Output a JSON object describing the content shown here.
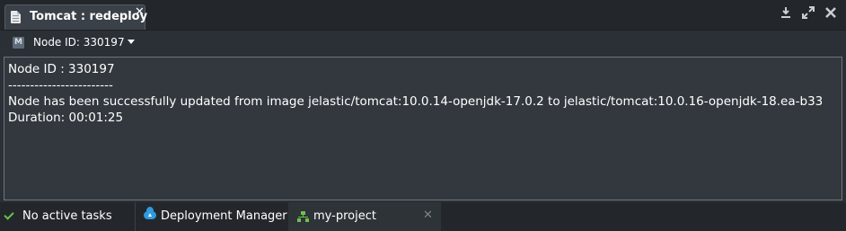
{
  "window": {
    "tab_title": "Tomcat : redeploy",
    "tab_close": "✕",
    "icons": [
      "download-icon",
      "expand-icon",
      "close-icon"
    ]
  },
  "toolbar": {
    "node_badge": "M",
    "node_selector": "Node ID: 330197"
  },
  "log": {
    "lines": [
      "Node ID : 330197",
      "------------------------",
      "Node has been successfully updated from image jelastic/tomcat:10.0.14-openjdk-17.0.2 to jelastic/tomcat:10.0.16-openjdk-18.ea-b33",
      "Duration: 00:01:25"
    ]
  },
  "statusbar": {
    "tasks": "No active tasks",
    "deployment_manager": "Deployment Manager",
    "project": "my-project",
    "project_close": "✕"
  },
  "colors": {
    "accent_green": "#6cc24a",
    "accent_blue": "#2f9be0",
    "panel_bg": "#2b3036",
    "log_bg": "#33383e"
  }
}
